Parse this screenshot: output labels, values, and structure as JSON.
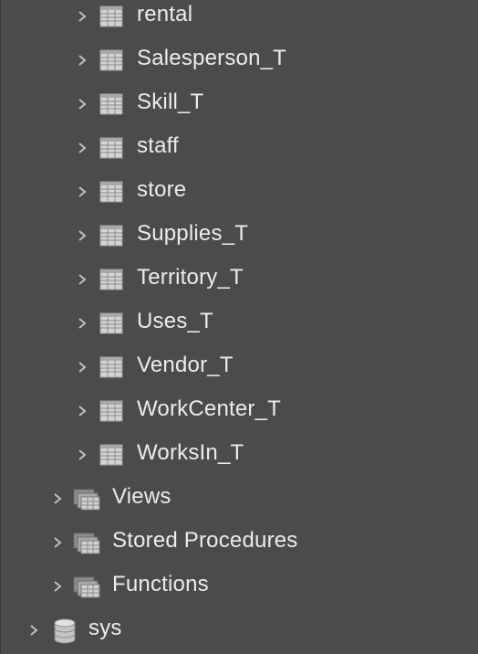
{
  "tables": [
    {
      "label": "rental",
      "icon": "table-icon"
    },
    {
      "label": "Salesperson_T",
      "icon": "table-icon"
    },
    {
      "label": "Skill_T",
      "icon": "table-icon"
    },
    {
      "label": "staff",
      "icon": "table-icon"
    },
    {
      "label": "store",
      "icon": "table-icon"
    },
    {
      "label": "Supplies_T",
      "icon": "table-icon"
    },
    {
      "label": "Territory_T",
      "icon": "table-icon"
    },
    {
      "label": "Uses_T",
      "icon": "table-icon"
    },
    {
      "label": "Vendor_T",
      "icon": "table-icon"
    },
    {
      "label": "WorkCenter_T",
      "icon": "table-icon"
    },
    {
      "label": "WorksIn_T",
      "icon": "table-icon"
    }
  ],
  "groups": [
    {
      "label": "Views",
      "icon": "views-folder-icon"
    },
    {
      "label": "Stored Procedures",
      "icon": "procedures-folder-icon"
    },
    {
      "label": "Functions",
      "icon": "functions-folder-icon"
    }
  ],
  "schemas": [
    {
      "label": "sys",
      "icon": "database-icon"
    }
  ],
  "colors": {
    "background": "#4b4b4b",
    "text": "#ececec",
    "chevron": "#bfbfbf",
    "icon": "#c8c8c8"
  }
}
